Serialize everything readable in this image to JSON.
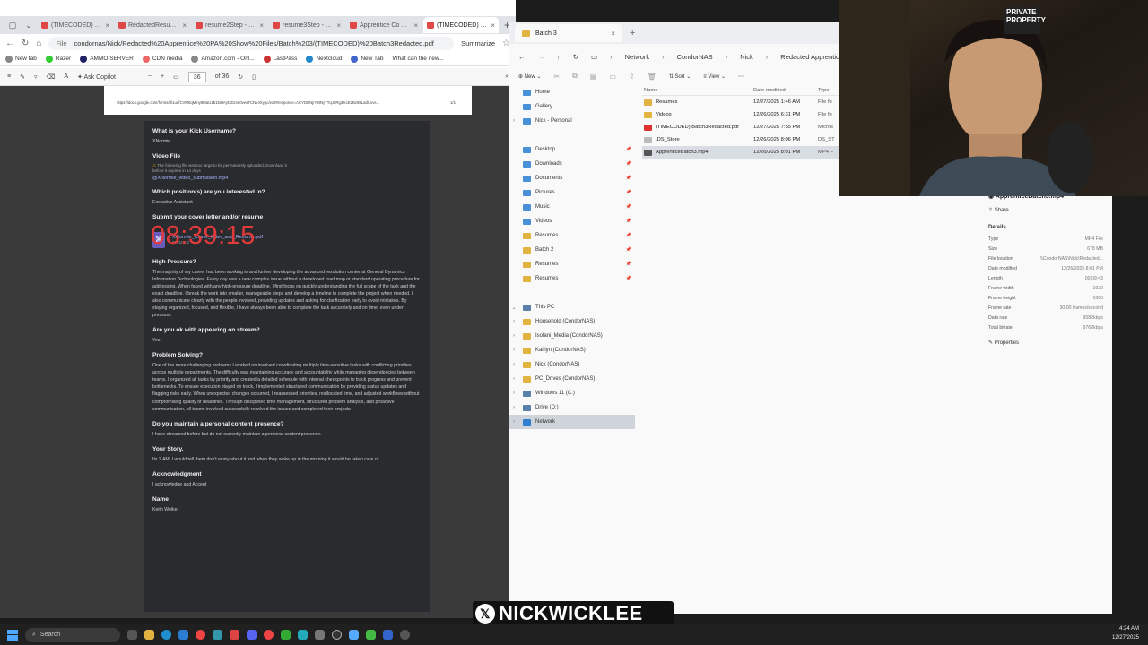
{
  "browser": {
    "tabs": [
      {
        "label": "(TIMECODED) Batch3",
        "active": false
      },
      {
        "label": "RedactedResume_F...",
        "active": false
      },
      {
        "label": "resume2Step - Ry...",
        "active": false
      },
      {
        "label": "resume3Step - Ry...",
        "active": false
      },
      {
        "label": "Apprentice Co Execut...",
        "active": false
      },
      {
        "label": "(TIMECODED) Batch3",
        "active": true
      }
    ],
    "address": {
      "prefix": "File",
      "url": "condornas/Nick/Redacted%20Apprentice%20PA%20Show%20Files/Batch%203/(TIMECODED)%20Batch3Redacted.pdf",
      "summarize": "Summarize"
    },
    "bookmarks": [
      "New tab",
      "Razer",
      "AMMO SERVER",
      "CDN media",
      "Amazon.com - Onl...",
      "LastPass",
      "Nextcloud",
      "New Tab",
      "What can the new..."
    ],
    "pdf_toolbar": {
      "ask_copilot": "Ask Copilot",
      "page": "36",
      "page_total": "of 36"
    }
  },
  "pdf": {
    "top_url": "https://docs.google.com/forms/d/1udfCVM0qMiny9MaU1b15iHAyt3Dzsn0vesTCNe4Xygc/edit#response=ACYDBNjrY3INyTTqJ6Rg3tkcE2Bz65LadUsvs...",
    "top_page": "1/1",
    "timer": "08:39:15",
    "q_username": "What is your Kick Username?",
    "a_username": "XNormie",
    "q_video": "Video File",
    "video_warning": "The following file was too large to be permanently uploaded. Download it before it expires in 14 days",
    "video_link": "@XNormie_video_submission.mp4",
    "q_position": "Which position(s) are you interested in?",
    "a_position": "Executive Assistant",
    "q_cover": "Submit your cover letter and/or resume",
    "cover_file": "XNormie_Cover_letter_and_Resume.pdf",
    "cover_size": "77.42 KB",
    "q_pressure": "High Pressure?",
    "a_pressure": "The majority of my career has been working in and further developing the advanced resolution center at General Dynamics Information Technologies. Every day was a new complex issue without a developed road map or standard operating procedure for addressing. When faced with any high-pressure deadline, I first focus on quickly understanding the full scope of the task and the exact deadline. I break the work into smaller, manageable steps and develop a timeline to complete the project when needed. I also communicate clearly with the people involved, providing updates and asking for clarification early to avoid mistakes. By staying organized, focused, and flexible, I have always been able to complete the task accurately and on time, even under pressure.",
    "q_stream": "Are you ok with appearing on stream?",
    "a_stream": "Yes",
    "q_problem": "Problem Solving?",
    "a_problem": "One of the more challenging problems I worked on involved coordinating multiple time-sensitive tasks with conflicting priorities across multiple departments. The difficulty was maintaining accuracy and accountability while managing dependencies between teams. I organized all tasks by priority and created a detailed schedule with internal checkpoints to track progress and prevent bottlenecks. To ensure execution stayed on track, I implemented structured communication by providing status updates and flagging risks early. When unexpected changes occurred, I reassessed priorities, reallocated time, and adjusted workflows without compromising quality or deadlines. Through disciplined time management, structured problem analysis, and proactive communication, all teams involved successfully resolved the issues and completed their projects",
    "q_content": "Do you maintain a personal content presence?",
    "a_content": "I have streamed before but do not currently maintain a personal content presence.",
    "q_story": "Your Story.",
    "a_story": "Its 2 AM, I would tell them don't worry about it and  when they woke up in the morning it would be taken care of.",
    "q_ack": "Acknowledgment",
    "a_ack": "I acknowledge and Accept",
    "q_name": "Name",
    "a_name": "Keith Welker"
  },
  "explorer": {
    "tab": "Batch 3",
    "breadcrumb": [
      "Network",
      "CondorNAS",
      "Nick",
      "Redacted Apprentice PA Show"
    ],
    "commands": {
      "new": "New",
      "sort": "Sort",
      "view": "View"
    },
    "nav": [
      {
        "label": "Home",
        "icon": "home-icon",
        "chev": ""
      },
      {
        "label": "Gallery",
        "icon": "gallery-icon",
        "chev": ""
      },
      {
        "label": "Nick - Personal",
        "icon": "cloud-icon",
        "chev": "›"
      },
      {
        "label": "",
        "icon": "",
        "chev": ""
      },
      {
        "label": "Desktop",
        "icon": "desktop-icon",
        "chev": "",
        "pin": true
      },
      {
        "label": "Downloads",
        "icon": "download-icon",
        "chev": "",
        "pin": true
      },
      {
        "label": "Documents",
        "icon": "documents-icon",
        "chev": "",
        "pin": true
      },
      {
        "label": "Pictures",
        "icon": "pictures-icon",
        "chev": "",
        "pin": true
      },
      {
        "label": "Music",
        "icon": "music-icon",
        "chev": "",
        "pin": true
      },
      {
        "label": "Videos",
        "icon": "videos-icon",
        "chev": "",
        "pin": true
      },
      {
        "label": "Resumes",
        "icon": "folder-icon",
        "chev": "",
        "pin": true
      },
      {
        "label": "Batch 2",
        "icon": "folder-icon",
        "chev": "",
        "pin": true
      },
      {
        "label": "Resumes",
        "icon": "folder-icon",
        "chev": "",
        "pin": true
      },
      {
        "label": "Resumes",
        "icon": "folder-icon",
        "chev": "",
        "pin": true
      },
      {
        "label": "",
        "icon": "",
        "chev": ""
      },
      {
        "label": "This PC",
        "icon": "pc-icon",
        "chev": "⌄"
      },
      {
        "label": "Household (CondorNAS)",
        "icon": "folder-icon",
        "chev": "›"
      },
      {
        "label": "Isolani_Media (CondorNAS)",
        "icon": "folder-icon",
        "chev": "›"
      },
      {
        "label": "Kaitlyn (CondorNAS)",
        "icon": "folder-icon",
        "chev": "›"
      },
      {
        "label": "Nick (CondorNAS)",
        "icon": "folder-icon",
        "chev": "›"
      },
      {
        "label": "PC_Drives (CondorNAS)",
        "icon": "folder-icon",
        "chev": "›"
      },
      {
        "label": "Windows 11 (C:)",
        "icon": "drive-icon",
        "chev": "›"
      },
      {
        "label": "Drive (D:)",
        "icon": "drive-icon",
        "chev": "›"
      },
      {
        "label": "Network",
        "icon": "network-icon",
        "chev": "›",
        "selected": true
      }
    ],
    "columns": {
      "name": "Name",
      "date": "Date modified",
      "type": "Type"
    },
    "files": [
      {
        "name": "Resumes",
        "date": "12/27/2025 1:46 AM",
        "type": "File fo",
        "icon": "folder-icon"
      },
      {
        "name": "Videos",
        "date": "12/26/2025 6:31 PM",
        "type": "File fo",
        "icon": "folder-icon"
      },
      {
        "name": "(TIMECODED) Batch3Redacted.pdf",
        "date": "12/27/2025 7:55 PM",
        "type": "Micros",
        "icon": "pdf-icon"
      },
      {
        "name": ".DS_Store",
        "date": "12/26/2025 8:06 PM",
        "type": "DS_ST",
        "icon": "file-icon"
      },
      {
        "name": "ApprenticeBatch3.mp4",
        "date": "12/26/2025 8:01 PM",
        "type": "MP4 F",
        "icon": "video-file-icon",
        "selected": true
      }
    ],
    "details": {
      "title": "ApprenticeBatch3.mp4",
      "share": "Share",
      "heading": "Details",
      "rows": [
        {
          "k": "Type",
          "v": "MP4 File"
        },
        {
          "k": "Size",
          "v": "678 MB"
        },
        {
          "k": "File location",
          "v": "\\\\CondorNAS\\Nick\\Redacted..."
        },
        {
          "k": "Date modified",
          "v": "12/26/2025 8:01 PM"
        },
        {
          "k": "Length",
          "v": "00:09:43"
        },
        {
          "k": "Frame width",
          "v": "1920"
        },
        {
          "k": "Frame height",
          "v": "1080"
        },
        {
          "k": "Frame rate",
          "v": "30.00 frames/second"
        },
        {
          "k": "Data rate",
          "v": "9582kbps"
        },
        {
          "k": "Total bitrate",
          "v": "9762kbps"
        }
      ],
      "properties": "Properties"
    }
  },
  "webcam": {
    "sign_text": "PRIVATE PROPERTY"
  },
  "watermark": {
    "text": "NICKWICKLEE"
  },
  "taskbar": {
    "search": "Search",
    "time": "4:24 AM",
    "date": "12/27/2025"
  },
  "colors": {
    "timer": "#e03a3a",
    "accent": "#0067c0",
    "folder": "#e3b341",
    "form_bg": "#2a2b2e"
  }
}
